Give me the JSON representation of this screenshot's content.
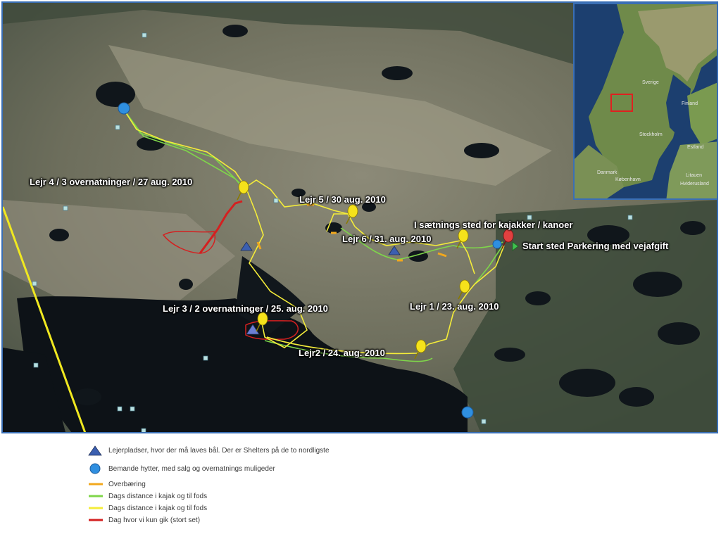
{
  "map": {
    "labels": {
      "lejr4": "Lejr 4 / 3 overnatninger / 27 aug. 2010",
      "lejr5": "Lejr 5 / 30 aug. 2010",
      "isaetning": "I sætnings sted for kajakker / kanoer",
      "lejr6": "Lejr 6 / 31. aug. 2010",
      "start": "Start sted Parkering med vejafgift",
      "lejr1": "Lejr 1 / 23. aug. 2010",
      "lejr3": "Lejr 3 / 2 overnatninger / 25. aug. 2010",
      "lejr2": "Lejr2 / 24. aug. 2010"
    },
    "colors": {
      "route_day": "#f4ec3a",
      "route_green": "#7fd64a",
      "route_red": "#d42020",
      "portage": "#f2a81d",
      "camp_triangle": "#3b5fb0",
      "hut_circle": "#2f8fe0",
      "pushpin": "#f5e21b",
      "start_pin": "#e04040"
    }
  },
  "inset": {
    "labels": {
      "sverige": "Sverige",
      "finland": "Finland",
      "stockholm": "Stockholm",
      "danmark": "Danmark",
      "kobenhavn": "København",
      "estland": "Estland",
      "litauen": "Litauen",
      "hviderusland": "Hviderusland"
    }
  },
  "legend": {
    "items": [
      {
        "symbol": "triangle",
        "color": "#3b5fb0",
        "text": "Lejerpladser, hvor der må laves bål. Der er Shelters på de to nordligste"
      },
      {
        "symbol": "circle",
        "color": "#2f8fe0",
        "text": "Bemande hytter, med salg og overnatnings muligeder"
      },
      {
        "symbol": "line",
        "color": "#f2a81d",
        "text": "Overbæring"
      },
      {
        "symbol": "line",
        "color": "#7fd64a",
        "text": "Dags distance i kajak og til fods"
      },
      {
        "symbol": "line",
        "color": "#f4ec3a",
        "text": "Dags distance i kajak og til fods"
      },
      {
        "symbol": "line",
        "color": "#d42020",
        "text": "Dag hvor vi kun gik (stort set)"
      }
    ]
  }
}
